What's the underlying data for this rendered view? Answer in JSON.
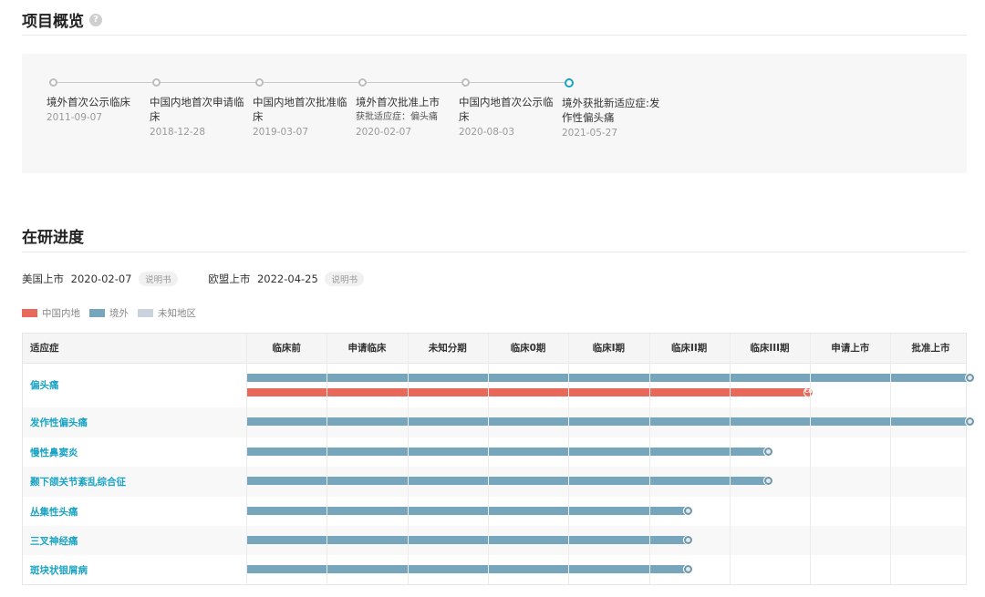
{
  "overview": {
    "title": "项目概览",
    "help_icon": "?",
    "events": [
      {
        "title": "境外首次公示临床",
        "sub": "",
        "date": "2011-09-07",
        "active": false
      },
      {
        "title": "中国内地首次申请临床",
        "sub": "",
        "date": "2018-12-28",
        "active": false
      },
      {
        "title": "中国内地首次批准临床",
        "sub": "",
        "date": "2019-03-07",
        "active": false
      },
      {
        "title": "境外首次批准上市",
        "sub": "获批适应症：偏头痛",
        "date": "2020-02-07",
        "active": false
      },
      {
        "title": "中国内地首次公示临床",
        "sub": "",
        "date": "2020-08-03",
        "active": false
      },
      {
        "title": "境外获批新适应症:发作性偏头痛",
        "sub": "",
        "date": "2021-05-27",
        "active": true
      }
    ]
  },
  "progress": {
    "title": "在研进度",
    "launches": [
      {
        "label": "美国上市",
        "date": "2020-02-07",
        "tag": "说明书"
      },
      {
        "label": "欧盟上市",
        "date": "2022-04-25",
        "tag": "说明书"
      }
    ],
    "legend": [
      {
        "label": "中国内地",
        "color": "#e8695a"
      },
      {
        "label": "境外",
        "color": "#77a5bb"
      },
      {
        "label": "未知地区",
        "color": "#c9d3dd"
      }
    ],
    "columns": [
      "适应症",
      "临床前",
      "申请临床",
      "未知分期",
      "临床0期",
      "临床I期",
      "临床II期",
      "临床III期",
      "申请上市",
      "批准上市"
    ],
    "rows": [
      {
        "name": "偏头痛",
        "bars": [
          {
            "region": "abroad",
            "stage": 9
          },
          {
            "region": "cn",
            "stage": 7,
            "marker": "CN"
          }
        ]
      },
      {
        "name": "发作性偏头痛",
        "bars": [
          {
            "region": "abroad",
            "stage": 9
          }
        ]
      },
      {
        "name": "慢性鼻窦炎",
        "bars": [
          {
            "region": "abroad",
            "stage": 6.5
          }
        ]
      },
      {
        "name": "颞下颌关节紊乱综合征",
        "bars": [
          {
            "region": "abroad",
            "stage": 6.5
          }
        ]
      },
      {
        "name": "丛集性头痛",
        "bars": [
          {
            "region": "abroad",
            "stage": 5.5
          }
        ]
      },
      {
        "name": "三叉神经痛",
        "bars": [
          {
            "region": "abroad",
            "stage": 5.5
          }
        ]
      },
      {
        "name": "斑块状银屑病",
        "bars": [
          {
            "region": "abroad",
            "stage": 5.5
          }
        ]
      }
    ]
  }
}
